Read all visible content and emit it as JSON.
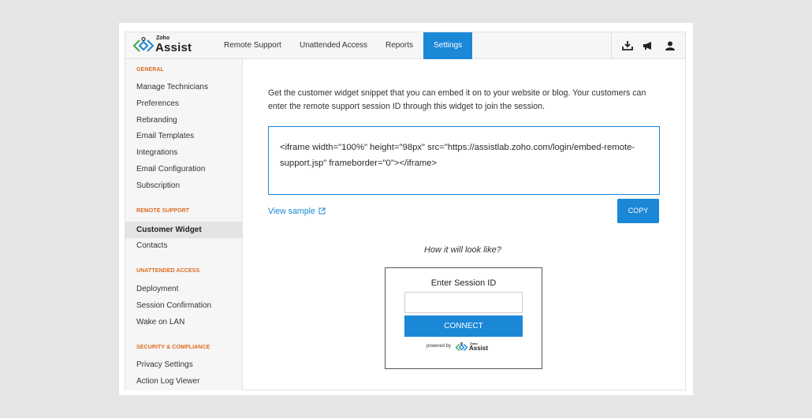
{
  "header": {
    "logo_small": "Zoho",
    "logo_big": "Assist",
    "tabs": [
      {
        "label": "Remote Support"
      },
      {
        "label": "Unattended Access"
      },
      {
        "label": "Reports"
      },
      {
        "label": "Settings"
      }
    ],
    "icons": [
      "download-icon",
      "announcement-icon",
      "user-icon"
    ],
    "accent": "#1b87d7"
  },
  "sidebar": {
    "general": {
      "title": "GENERAL",
      "items": [
        "Manage Technicians",
        "Preferences",
        "Rebranding",
        "Email Templates",
        "Integrations",
        "Email Configuration",
        "Subscription"
      ]
    },
    "remote_support": {
      "title": "REMOTE SUPPORT",
      "items": [
        "Customer Widget",
        "Contacts"
      ]
    },
    "unattended_access": {
      "title": "UNATTENDED ACCESS",
      "items": [
        "Deployment",
        "Session Confirmation",
        "Wake on LAN"
      ]
    },
    "security": {
      "title": "SECURITY & COMPLIANCE",
      "items": [
        "Privacy Settings",
        "Action Log Viewer"
      ]
    },
    "section_color": "#dd6a1f"
  },
  "main": {
    "description": "Get the customer widget snippet that you can embed it on to your website or blog. Your customers can enter the remote support session ID through this widget to join the session.",
    "snippet": "<iframe width=\"100%\" height=\"98px\" src=\"https://assistlab.zoho.com/login/embed-remote-support.jsp\" frameborder=\"0\"></iframe>",
    "view_sample": "View sample",
    "copy_label": "COPY",
    "preview_question": "How it will look like?"
  },
  "widget": {
    "title": "Enter Session ID",
    "input_value": "",
    "connect_label": "CONNECT",
    "powered_by": "powered by",
    "logo_small": "Zoho",
    "logo_big": "Assist"
  }
}
